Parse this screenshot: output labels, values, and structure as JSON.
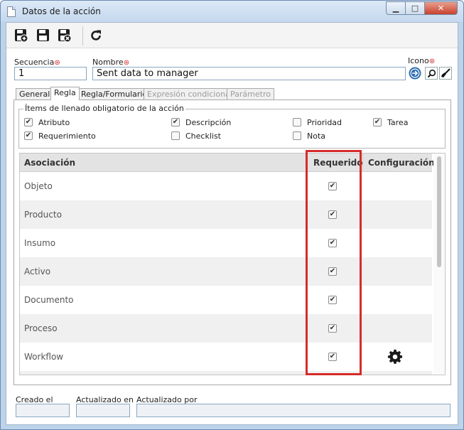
{
  "window": {
    "title": "Datos de la acción",
    "controls": {
      "minimize": "▁",
      "maximize": "□",
      "close": "✕"
    }
  },
  "toolbar": {
    "buttons": [
      {
        "name": "save-new-icon"
      },
      {
        "name": "save-icon"
      },
      {
        "name": "save-close-icon"
      },
      {
        "name": "refresh-icon"
      }
    ]
  },
  "form": {
    "secuencia_label": "Secuencia",
    "secuencia_value": "1",
    "nombre_label": "Nombre",
    "nombre_value": "Sent data to manager",
    "icono_label": "Icono",
    "required_mark": "⊛"
  },
  "tabs": [
    {
      "label": "General",
      "state": "normal"
    },
    {
      "label": "Regla",
      "state": "active"
    },
    {
      "label": "Regla/Formulario",
      "state": "normal"
    },
    {
      "label": "Expresión condicional",
      "state": "disabled"
    },
    {
      "label": "Parámetro",
      "state": "disabled"
    }
  ],
  "mandatory_items": {
    "legend": "Ítems de llenado obligatorio de la acción",
    "items": [
      {
        "label": "Atributo",
        "checked": true
      },
      {
        "label": "Descripción",
        "checked": true
      },
      {
        "label": "Prioridad",
        "checked": false
      },
      {
        "label": "Tarea",
        "checked": true
      },
      {
        "label": "Requerimiento",
        "checked": true
      },
      {
        "label": "Checklist",
        "checked": false
      },
      {
        "label": "Nota",
        "checked": false
      }
    ]
  },
  "grid": {
    "headers": [
      "Asociación",
      "Requerido",
      "Configuración"
    ],
    "rows": [
      {
        "label": "Objeto",
        "required": true,
        "config": false
      },
      {
        "label": "Producto",
        "required": true,
        "config": false
      },
      {
        "label": "Insumo",
        "required": true,
        "config": false
      },
      {
        "label": "Activo",
        "required": true,
        "config": false
      },
      {
        "label": "Documento",
        "required": true,
        "config": false
      },
      {
        "label": "Proceso",
        "required": true,
        "config": false
      },
      {
        "label": "Workflow",
        "required": true,
        "config": true
      }
    ],
    "check_glyph": "✔"
  },
  "footer": {
    "creado_label": "Creado el",
    "actualizado_en_label": "Actualizado en",
    "actualizado_por_label": "Actualizado por"
  },
  "colors": {
    "highlight": "#d62b2b",
    "required_mark": "#d62b2b",
    "window_frame": "#bcd3ea"
  }
}
